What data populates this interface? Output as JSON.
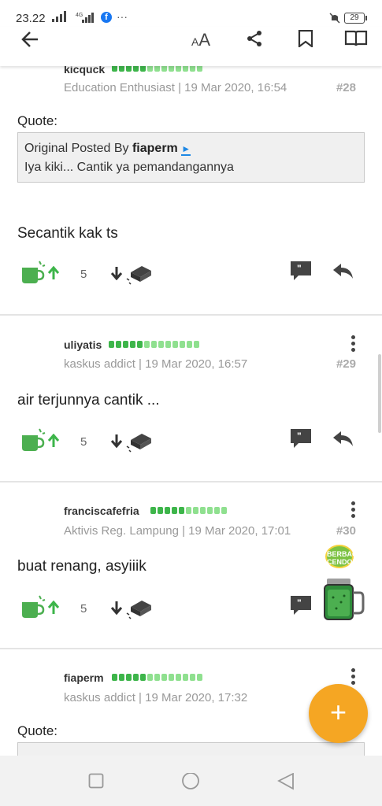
{
  "status_bar": {
    "time": "23.22",
    "network": "4G",
    "battery": "29"
  },
  "toolbar": {
    "font_small": "A",
    "font_large": "A"
  },
  "posts": [
    {
      "username": "kicquck",
      "title": "Education Enthusiast",
      "timestamp": "19 Mar 2020, 16:54",
      "number": "#28",
      "quote_label": "Quote:",
      "quote_prefix": "Original Posted By",
      "quote_author": "fiaperm",
      "quote_text": "Iya kiki... Cantik ya pemandangannya",
      "text": "Secantik kak ts",
      "cendol_count": "5"
    },
    {
      "username": "uliyatis",
      "title": "kaskus addict",
      "timestamp": "19 Mar 2020, 16:57",
      "number": "#29",
      "text": "air terjunnya cantik ...",
      "cendol_count": "5"
    },
    {
      "username": "franciscafefria",
      "title": "Aktivis Reg. Lampung",
      "timestamp": "19 Mar 2020, 17:01",
      "number": "#30",
      "text": "buat renang, asyiiik",
      "cendol_count": "5",
      "badge": "BERBAGI CENDOL"
    },
    {
      "username": "fiaperm",
      "title": "kaskus addict",
      "timestamp": "19 Mar 2020, 17:32",
      "quote_label": "Quote:"
    }
  ],
  "fab": {
    "label": "+"
  },
  "colors": {
    "accent_green": "#3db54a",
    "fab_orange": "#f5a623",
    "post_number": "#aaaaaa"
  }
}
